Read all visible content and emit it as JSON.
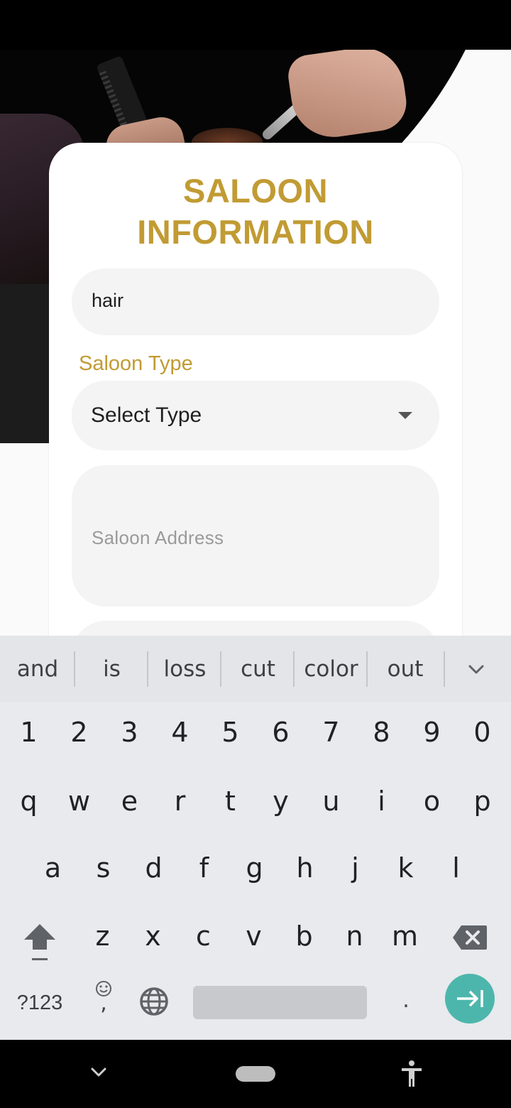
{
  "form": {
    "title_line1": "SALOON",
    "title_line2": "INFORMATION",
    "name_value": "hair",
    "type_label": "Saloon Type",
    "type_value": "Select Type",
    "address_placeholder": "Saloon Address"
  },
  "keyboard": {
    "suggestions": [
      "and",
      "is",
      "loss",
      "cut",
      "color",
      "out"
    ],
    "row_numbers": [
      "1",
      "2",
      "3",
      "4",
      "5",
      "6",
      "7",
      "8",
      "9",
      "0"
    ],
    "row1": [
      "q",
      "w",
      "e",
      "r",
      "t",
      "y",
      "u",
      "i",
      "o",
      "p"
    ],
    "row2": [
      "a",
      "s",
      "d",
      "f",
      "g",
      "h",
      "j",
      "k",
      "l"
    ],
    "row3": [
      "z",
      "x",
      "c",
      "v",
      "b",
      "n",
      "m"
    ],
    "symbols_label": "?123",
    "comma": ",",
    "period": "."
  },
  "colors": {
    "accent": "#c19b33",
    "enter_key": "#4db6ac",
    "field_bg": "#f4f4f4"
  },
  "icons": {
    "collapse": "chevron-down-icon",
    "shift": "shift-icon",
    "backspace": "backspace-icon",
    "emoji": "emoji-icon",
    "globe": "globe-icon",
    "enter": "tab-forward-icon",
    "nav_back": "chevron-down-icon",
    "nav_home": "home-pill-icon",
    "nav_accessibility": "accessibility-icon"
  }
}
